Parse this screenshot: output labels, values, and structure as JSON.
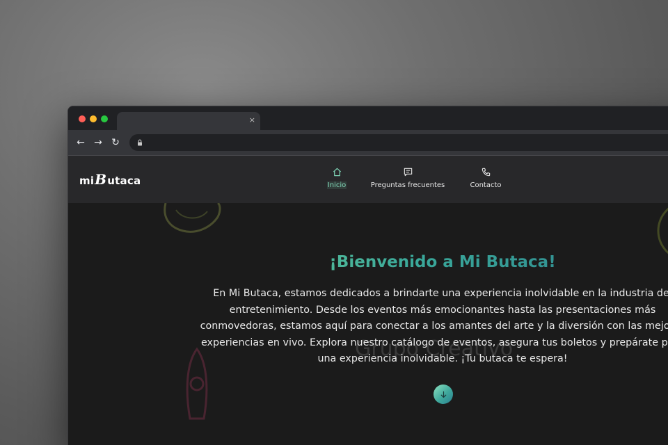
{
  "browser": {
    "tab_close_glyph": "×",
    "back_glyph": "←",
    "forward_glyph": "→",
    "reload_glyph": "↻"
  },
  "site": {
    "logo": {
      "prefix": "mi",
      "b": "B",
      "suffix": "utaca"
    },
    "nav": [
      {
        "label": "Inicio",
        "icon": "home-icon",
        "active": true
      },
      {
        "label": "Preguntas frecuentes",
        "icon": "message-square-icon",
        "active": false
      },
      {
        "label": "Contacto",
        "icon": "phone-icon",
        "active": false
      }
    ],
    "accent_colors": [
      "#6ccf99",
      "#2b7f8c"
    ]
  },
  "hero": {
    "title": "¡Bienvenido a Mi Butaca!",
    "text": "En Mi Butaca, estamos dedicados a brindarte una experiencia inolvidable en la industria del entretenimiento. Desde los eventos más emocionantes hasta las presentaciones más conmovedoras, estamos aquí para conectar a los amantes del arte y la diversión con las mejores experiencias en vivo. Explora nuestro catálogo de eventos, asegura tus boletos y prepárate para una experiencia inolvidable. ¡Tu butaca te espera!",
    "watermark": "Grupo Creativo",
    "scroll_icon": "arrow-down-icon"
  }
}
